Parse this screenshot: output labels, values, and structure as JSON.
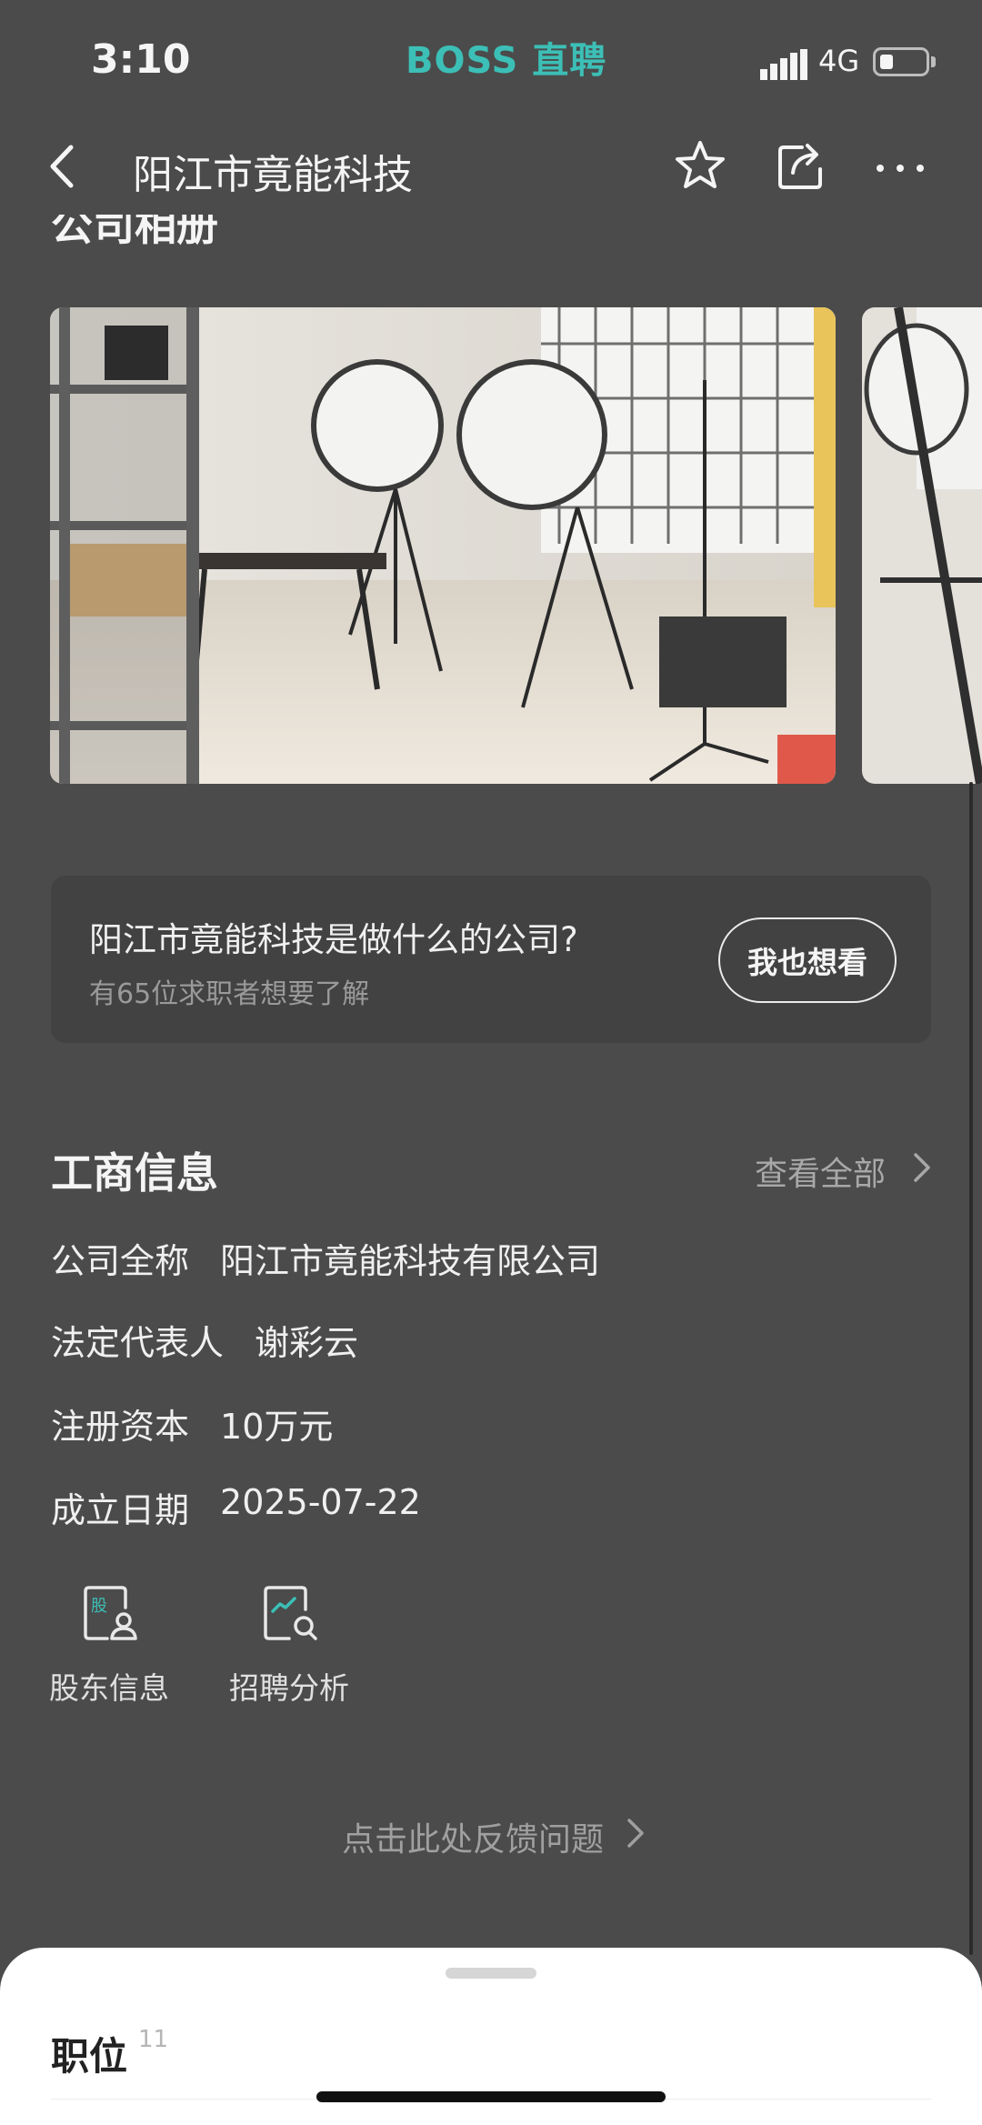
{
  "status_bar": {
    "time": "3:10",
    "brand": "BOSS 直聘",
    "network": "4G",
    "accent_color": "#3cbfb6"
  },
  "nav": {
    "title": "阳江市竟能科技",
    "icons": [
      "back-icon",
      "star-icon",
      "share-icon",
      "more-icon"
    ]
  },
  "album": {
    "title": "公司相册"
  },
  "question_card": {
    "title": "阳江市竟能科技是做什么的公司?",
    "subtitle": "有65位求职者想要了解",
    "button": "我也想看"
  },
  "business_info": {
    "title": "工商信息",
    "view_all": "查看全部",
    "rows": [
      {
        "label": "公司全称",
        "value": "阳江市竟能科技有限公司"
      },
      {
        "label": "法定代表人",
        "value": "谢彩云"
      },
      {
        "label": "注册资本",
        "value": "10万元"
      },
      {
        "label": "成立日期",
        "value": "2025-07-22"
      }
    ],
    "tools": [
      {
        "label": "股东信息",
        "icon": "shareholder-icon"
      },
      {
        "label": "招聘分析",
        "icon": "recruit-analysis-icon"
      }
    ]
  },
  "feedback": {
    "label": "点击此处反馈问题"
  },
  "bottom_sheet": {
    "tab": "职位",
    "count": "11"
  }
}
